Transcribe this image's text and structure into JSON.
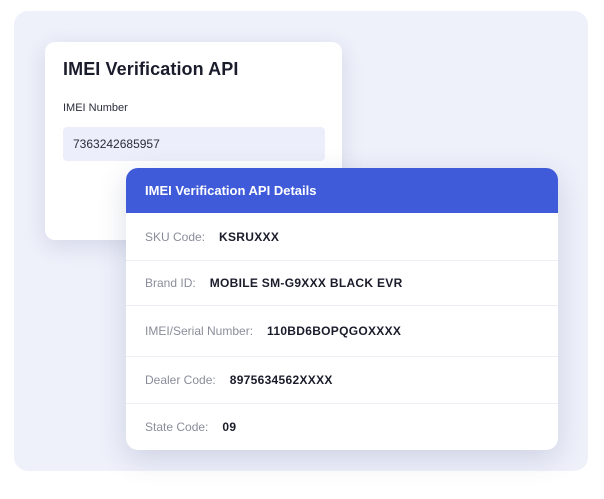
{
  "form": {
    "title": "IMEI Verification API",
    "imei_label": "IMEI Number",
    "imei_value": "7363242685957"
  },
  "details": {
    "header": "IMEI Verification API Details",
    "rows": [
      {
        "label": "SKU Code:",
        "value": "KSRUXXX"
      },
      {
        "label": "Brand ID:",
        "value": "MOBILE SM-G9XXX BLACK EVR"
      },
      {
        "label": "IMEI/Serial Number:",
        "value": "110BD6BOPQGOXXXX"
      },
      {
        "label": "Dealer Code:",
        "value": "8975634562XXXX"
      },
      {
        "label": "State Code:",
        "value": "09"
      }
    ]
  },
  "colors": {
    "accent": "#3f5bd9",
    "backdrop": "#eef0fa",
    "input_bg": "#eceefb"
  }
}
